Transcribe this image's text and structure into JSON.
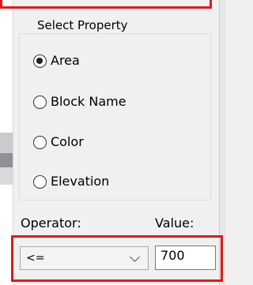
{
  "select_property": {
    "title": "Select Property",
    "options": [
      {
        "label": "Area",
        "checked": true
      },
      {
        "label": "Block Name",
        "checked": false
      },
      {
        "label": "Color",
        "checked": false
      },
      {
        "label": "Elevation",
        "checked": false
      }
    ]
  },
  "operator": {
    "label": "Operator:",
    "selected": "<="
  },
  "value": {
    "label": "Value:",
    "text": "700"
  },
  "colors": {
    "highlight": "#e0191c",
    "dialog_bg": "#f0f0f0"
  }
}
